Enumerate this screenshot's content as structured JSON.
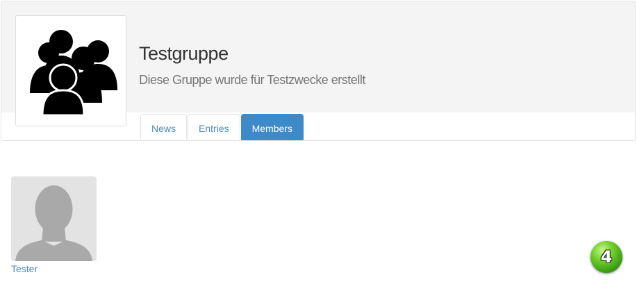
{
  "group": {
    "title": "Testgruppe",
    "description": "Diese Gruppe wurde für Testzwecke erstellt",
    "avatar_icon": "group-people-icon"
  },
  "tabs": [
    {
      "label": "News",
      "active": false
    },
    {
      "label": "Entries",
      "active": false
    },
    {
      "label": "Members",
      "active": true
    }
  ],
  "members": [
    {
      "name": "Tester",
      "avatar_icon": "default-user-icon"
    }
  ],
  "badge": {
    "value": "4"
  },
  "colors": {
    "link": "#4a8bc2",
    "active_tab": "#3e8ac9",
    "header_bg": "#f4f4f4",
    "badge": "#4caf1a"
  }
}
